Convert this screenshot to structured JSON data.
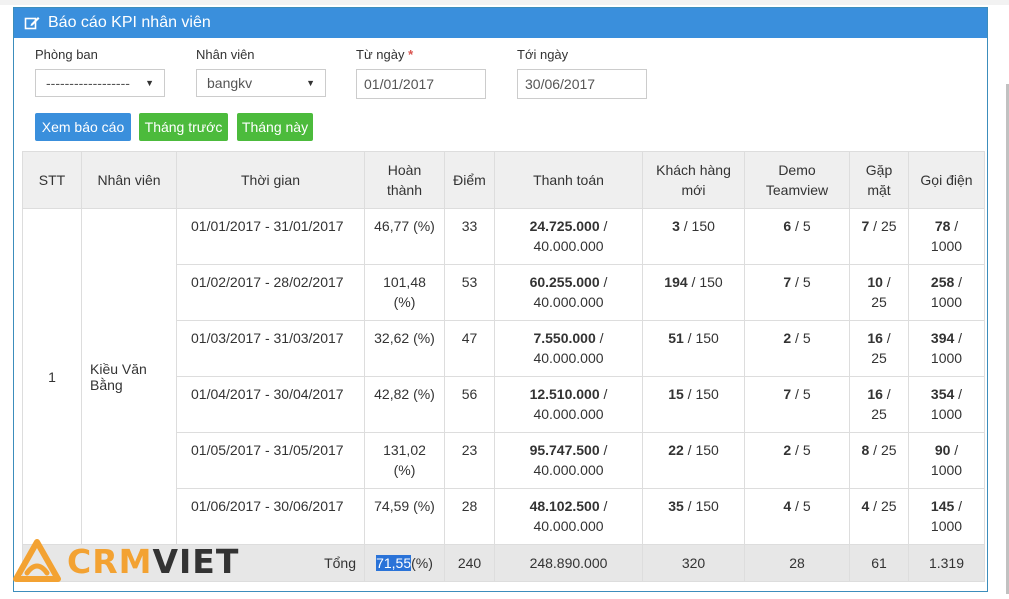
{
  "panel": {
    "title": "Báo cáo KPI nhân viên",
    "icon": "edit-icon"
  },
  "filters": {
    "department_label": "Phòng ban",
    "department_value": "------------------",
    "employee_label": "Nhân viên",
    "employee_value": "bangkv",
    "from_label": "Từ ngày",
    "required_mark": "*",
    "from_value": "01/01/2017",
    "to_label": "Tới ngày",
    "to_value": "30/06/2017"
  },
  "buttons": {
    "view": "Xem báo cáo",
    "prev_month": "Tháng trước",
    "this_month": "Tháng này"
  },
  "table": {
    "headers": {
      "stt": "STT",
      "employee": "Nhân viên",
      "period": "Thời gian",
      "completion": [
        "Hoàn",
        "thành"
      ],
      "score": "Điểm",
      "payment": "Thanh toán",
      "new_customers": [
        "Khách hàng",
        "mới"
      ],
      "demo": [
        "Demo",
        "Teamview"
      ],
      "meeting": [
        "Gặp",
        "mặt"
      ],
      "calls": "Gọi điện"
    },
    "stt": "1",
    "employee_name": [
      "Kiều Văn",
      "Bằng"
    ],
    "rows": [
      {
        "period": "01/01/2017 - 31/01/2017",
        "completion": [
          "46,77 (%)",
          ""
        ],
        "score": "33",
        "pay_actual": "24.725.000",
        "pay_target": "40.000.000",
        "cust": "3",
        "cust_target": "150",
        "demo": "6",
        "demo_target": "5",
        "meet": "7",
        "meet_target": "25",
        "meet_wrap": false,
        "calls": "78",
        "calls_target": "1000"
      },
      {
        "period": "01/02/2017 - 28/02/2017",
        "completion": [
          "101,48",
          "(%)"
        ],
        "score": "53",
        "pay_actual": "60.255.000",
        "pay_target": "40.000.000",
        "cust": "194",
        "cust_target": "150",
        "demo": "7",
        "demo_target": "5",
        "meet": "10",
        "meet_target": "25",
        "meet_wrap": true,
        "calls": "258",
        "calls_target": "1000"
      },
      {
        "period": "01/03/2017 - 31/03/2017",
        "completion": [
          "32,62 (%)",
          ""
        ],
        "score": "47",
        "pay_actual": "7.550.000",
        "pay_target": "40.000.000",
        "cust": "51",
        "cust_target": "150",
        "demo": "2",
        "demo_target": "5",
        "meet": "16",
        "meet_target": "25",
        "meet_wrap": true,
        "calls": "394",
        "calls_target": "1000"
      },
      {
        "period": "01/04/2017 - 30/04/2017",
        "completion": [
          "42,82 (%)",
          ""
        ],
        "score": "56",
        "pay_actual": "12.510.000",
        "pay_target": "40.000.000",
        "cust": "15",
        "cust_target": "150",
        "demo": "7",
        "demo_target": "5",
        "meet": "16",
        "meet_target": "25",
        "meet_wrap": true,
        "calls": "354",
        "calls_target": "1000"
      },
      {
        "period": "01/05/2017 - 31/05/2017",
        "completion": [
          "131,02",
          "(%)"
        ],
        "score": "23",
        "pay_actual": "95.747.500",
        "pay_target": "40.000.000",
        "cust": "22",
        "cust_target": "150",
        "demo": "2",
        "demo_target": "5",
        "meet": "8",
        "meet_target": "25",
        "meet_wrap": false,
        "calls": "90",
        "calls_target": "1000"
      },
      {
        "period": "01/06/2017 - 30/06/2017",
        "completion": [
          "74,59 (%)",
          ""
        ],
        "score": "28",
        "pay_actual": "48.102.500",
        "pay_target": "40.000.000",
        "cust": "35",
        "cust_target": "150",
        "demo": "4",
        "demo_target": "5",
        "meet": "4",
        "meet_target": "25",
        "meet_wrap": false,
        "calls": "145",
        "calls_target": "1000"
      }
    ],
    "total": {
      "label": "Tổng",
      "completion_value": "71,55",
      "completion_unit": "(%)",
      "score": "240",
      "payment": "248.890.000",
      "customers": "320",
      "demo": "28",
      "meeting": "61",
      "calls": "1.319"
    }
  },
  "logo": {
    "part1": "CRM",
    "part2": "VIET",
    "color1": "#f3a232",
    "color2": "#333333"
  },
  "colors": {
    "primary": "#3a8fdc",
    "success": "#4cbb3c"
  }
}
